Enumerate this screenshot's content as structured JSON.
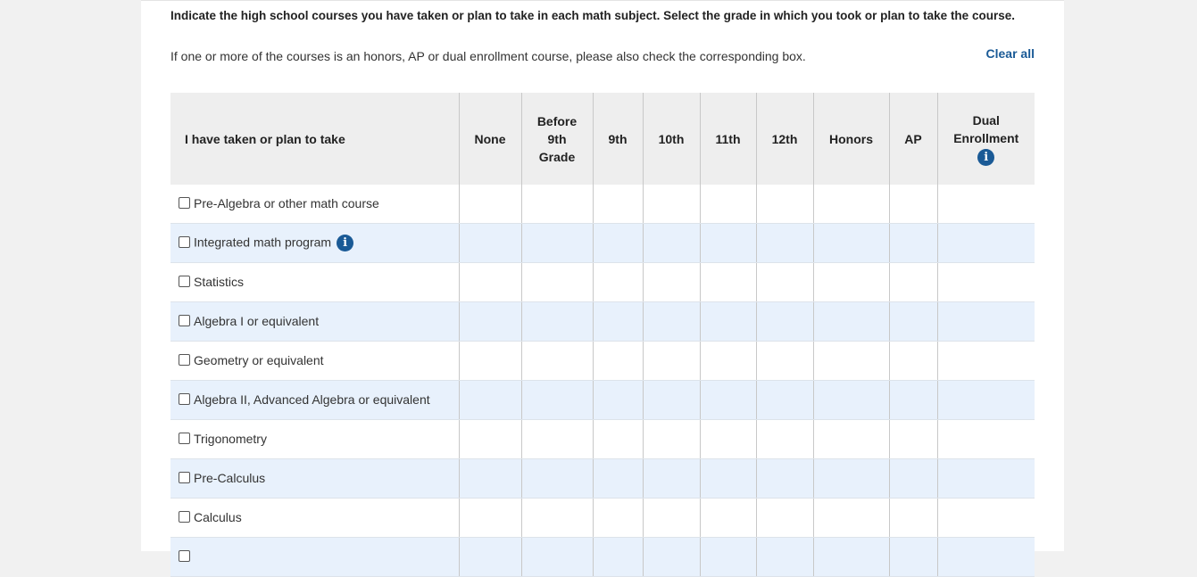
{
  "instructions": {
    "main": "Indicate the high school courses you have taken or plan to take in each math subject. Select the grade in which you took or plan to take the course.",
    "note": "If one or more of the courses is an honors, AP or dual enrollment course, please also check the corresponding box."
  },
  "clear_all_label": "Clear all",
  "info_icon_glyph": "i",
  "table": {
    "headers": {
      "course": "I have taken or plan to take",
      "none": "None",
      "before_1": "Before",
      "before_2": "9th",
      "before_3": "Grade",
      "g9": "9th",
      "g10": "10th",
      "g11": "11th",
      "g12": "12th",
      "honors": "Honors",
      "ap": "AP",
      "dual_1": "Dual",
      "dual_2": "Enrollment"
    },
    "rows": [
      {
        "label": "Pre-Algebra or other math course"
      },
      {
        "label": "Integrated math program"
      },
      {
        "label": "Statistics"
      },
      {
        "label": "Algebra I or equivalent"
      },
      {
        "label": "Geometry or equivalent"
      },
      {
        "label": "Algebra II, Advanced Algebra or equivalent"
      },
      {
        "label": "Trigonometry"
      },
      {
        "label": "Pre-Calculus"
      },
      {
        "label": "Calculus"
      },
      {
        "label": ""
      }
    ]
  },
  "colors": {
    "accent": "#1a5a96",
    "header_bg": "#eeeeee",
    "row_alt_bg": "#e8f1fc",
    "page_bg": "#f1f1f1"
  }
}
